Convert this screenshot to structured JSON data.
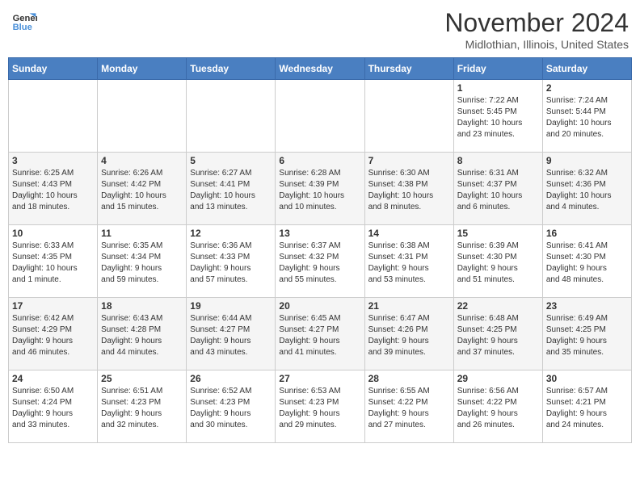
{
  "header": {
    "logo_line1": "General",
    "logo_line2": "Blue",
    "month_year": "November 2024",
    "location": "Midlothian, Illinois, United States"
  },
  "weekdays": [
    "Sunday",
    "Monday",
    "Tuesday",
    "Wednesday",
    "Thursday",
    "Friday",
    "Saturday"
  ],
  "weeks": [
    [
      {
        "day": "",
        "info": ""
      },
      {
        "day": "",
        "info": ""
      },
      {
        "day": "",
        "info": ""
      },
      {
        "day": "",
        "info": ""
      },
      {
        "day": "",
        "info": ""
      },
      {
        "day": "1",
        "info": "Sunrise: 7:22 AM\nSunset: 5:45 PM\nDaylight: 10 hours\nand 23 minutes."
      },
      {
        "day": "2",
        "info": "Sunrise: 7:24 AM\nSunset: 5:44 PM\nDaylight: 10 hours\nand 20 minutes."
      }
    ],
    [
      {
        "day": "3",
        "info": "Sunrise: 6:25 AM\nSunset: 4:43 PM\nDaylight: 10 hours\nand 18 minutes."
      },
      {
        "day": "4",
        "info": "Sunrise: 6:26 AM\nSunset: 4:42 PM\nDaylight: 10 hours\nand 15 minutes."
      },
      {
        "day": "5",
        "info": "Sunrise: 6:27 AM\nSunset: 4:41 PM\nDaylight: 10 hours\nand 13 minutes."
      },
      {
        "day": "6",
        "info": "Sunrise: 6:28 AM\nSunset: 4:39 PM\nDaylight: 10 hours\nand 10 minutes."
      },
      {
        "day": "7",
        "info": "Sunrise: 6:30 AM\nSunset: 4:38 PM\nDaylight: 10 hours\nand 8 minutes."
      },
      {
        "day": "8",
        "info": "Sunrise: 6:31 AM\nSunset: 4:37 PM\nDaylight: 10 hours\nand 6 minutes."
      },
      {
        "day": "9",
        "info": "Sunrise: 6:32 AM\nSunset: 4:36 PM\nDaylight: 10 hours\nand 4 minutes."
      }
    ],
    [
      {
        "day": "10",
        "info": "Sunrise: 6:33 AM\nSunset: 4:35 PM\nDaylight: 10 hours\nand 1 minute."
      },
      {
        "day": "11",
        "info": "Sunrise: 6:35 AM\nSunset: 4:34 PM\nDaylight: 9 hours\nand 59 minutes."
      },
      {
        "day": "12",
        "info": "Sunrise: 6:36 AM\nSunset: 4:33 PM\nDaylight: 9 hours\nand 57 minutes."
      },
      {
        "day": "13",
        "info": "Sunrise: 6:37 AM\nSunset: 4:32 PM\nDaylight: 9 hours\nand 55 minutes."
      },
      {
        "day": "14",
        "info": "Sunrise: 6:38 AM\nSunset: 4:31 PM\nDaylight: 9 hours\nand 53 minutes."
      },
      {
        "day": "15",
        "info": "Sunrise: 6:39 AM\nSunset: 4:30 PM\nDaylight: 9 hours\nand 51 minutes."
      },
      {
        "day": "16",
        "info": "Sunrise: 6:41 AM\nSunset: 4:30 PM\nDaylight: 9 hours\nand 48 minutes."
      }
    ],
    [
      {
        "day": "17",
        "info": "Sunrise: 6:42 AM\nSunset: 4:29 PM\nDaylight: 9 hours\nand 46 minutes."
      },
      {
        "day": "18",
        "info": "Sunrise: 6:43 AM\nSunset: 4:28 PM\nDaylight: 9 hours\nand 44 minutes."
      },
      {
        "day": "19",
        "info": "Sunrise: 6:44 AM\nSunset: 4:27 PM\nDaylight: 9 hours\nand 43 minutes."
      },
      {
        "day": "20",
        "info": "Sunrise: 6:45 AM\nSunset: 4:27 PM\nDaylight: 9 hours\nand 41 minutes."
      },
      {
        "day": "21",
        "info": "Sunrise: 6:47 AM\nSunset: 4:26 PM\nDaylight: 9 hours\nand 39 minutes."
      },
      {
        "day": "22",
        "info": "Sunrise: 6:48 AM\nSunset: 4:25 PM\nDaylight: 9 hours\nand 37 minutes."
      },
      {
        "day": "23",
        "info": "Sunrise: 6:49 AM\nSunset: 4:25 PM\nDaylight: 9 hours\nand 35 minutes."
      }
    ],
    [
      {
        "day": "24",
        "info": "Sunrise: 6:50 AM\nSunset: 4:24 PM\nDaylight: 9 hours\nand 33 minutes."
      },
      {
        "day": "25",
        "info": "Sunrise: 6:51 AM\nSunset: 4:23 PM\nDaylight: 9 hours\nand 32 minutes."
      },
      {
        "day": "26",
        "info": "Sunrise: 6:52 AM\nSunset: 4:23 PM\nDaylight: 9 hours\nand 30 minutes."
      },
      {
        "day": "27",
        "info": "Sunrise: 6:53 AM\nSunset: 4:23 PM\nDaylight: 9 hours\nand 29 minutes."
      },
      {
        "day": "28",
        "info": "Sunrise: 6:55 AM\nSunset: 4:22 PM\nDaylight: 9 hours\nand 27 minutes."
      },
      {
        "day": "29",
        "info": "Sunrise: 6:56 AM\nSunset: 4:22 PM\nDaylight: 9 hours\nand 26 minutes."
      },
      {
        "day": "30",
        "info": "Sunrise: 6:57 AM\nSunset: 4:21 PM\nDaylight: 9 hours\nand 24 minutes."
      }
    ]
  ]
}
